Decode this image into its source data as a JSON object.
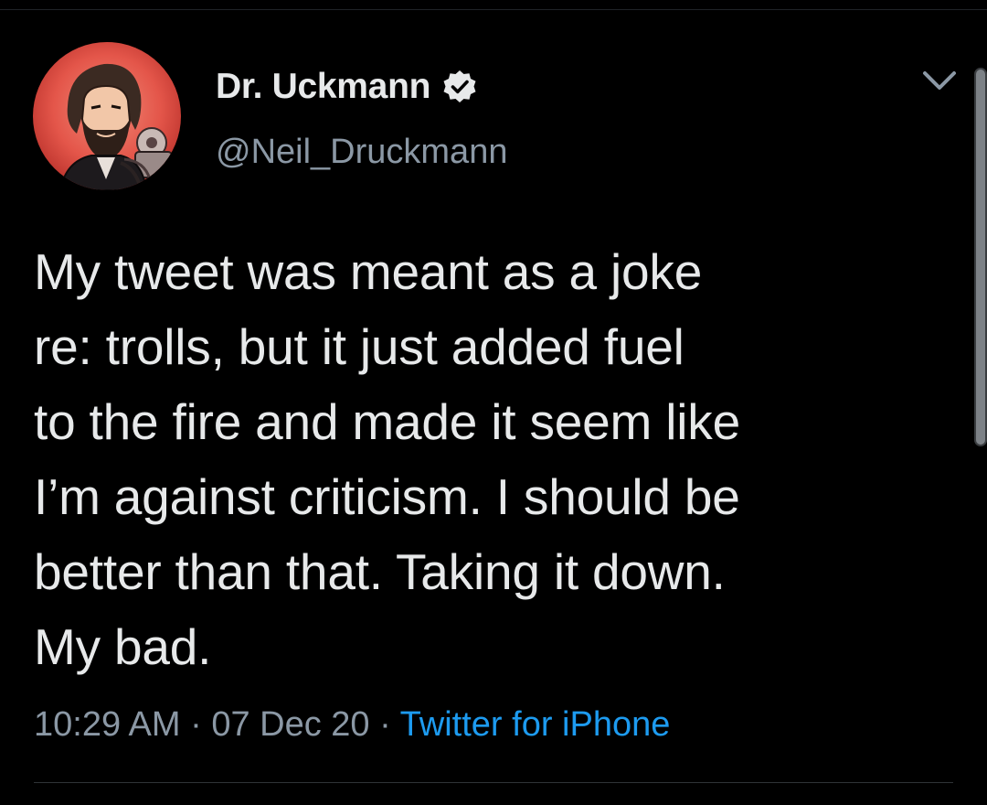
{
  "tweet": {
    "author": {
      "display_name": "Dr. Uckmann",
      "handle": "@Neil_Druckmann",
      "verified": true,
      "avatar_icon": "illustrated-bearded-man-avatar"
    },
    "text": "My tweet was meant as a joke\nre: trolls, but it just added fuel\nto the fire and made it seem like\nI’m against criticism. I should be\nbetter than that. Taking it down.\nMy bad.",
    "time": "10:29 AM",
    "separator": "·",
    "date": "07 Dec 20",
    "source": "Twitter for iPhone"
  },
  "icons": {
    "verified": "verified-badge-icon",
    "menu": "chevron-down-icon"
  },
  "colors": {
    "background": "#000000",
    "text_primary": "#e7e9ea",
    "text_secondary": "#8b98a5",
    "link": "#1d9bf0"
  }
}
